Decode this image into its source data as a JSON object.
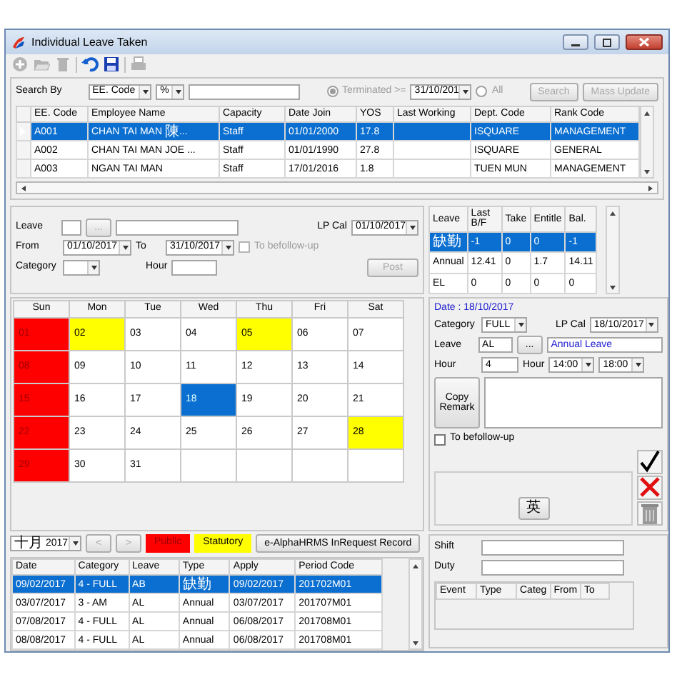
{
  "window": {
    "title": "Individual Leave Taken"
  },
  "toolbar": [
    {
      "kind": "add",
      "disabled": true
    },
    {
      "kind": "open",
      "disabled": true
    },
    {
      "kind": "delete",
      "disabled": true
    },
    {
      "kind": "undo",
      "disabled": false
    },
    {
      "kind": "save",
      "disabled": false
    },
    {
      "kind": "print",
      "disabled": true
    }
  ],
  "search": {
    "label": "Search By",
    "field": "EE. Code",
    "operator": "%",
    "terminated_option": {
      "label": "Terminated >=",
      "selected": true,
      "date": "31/10/201"
    },
    "all_option": {
      "label": "All",
      "selected": false
    },
    "buttons": [
      {
        "label": "Search",
        "disabled": true
      },
      {
        "label": "Mass Update",
        "disabled": true
      }
    ]
  },
  "employees": {
    "columns": [
      "EE. Code",
      "Employee Name",
      "Capacity",
      "Date Join",
      "YOS",
      "Last Working",
      "Dept. Code",
      "Rank Code"
    ],
    "rows": [
      {
        "cells": [
          "A001",
          "CHAN TAI MAN 陳...",
          "Staff",
          "01/01/2000",
          "17.8",
          "",
          "ISQUARE",
          "MANAGEMENT"
        ],
        "selected": true
      },
      {
        "cells": [
          "A002",
          "CHAN TAI MAN JOE ...",
          "Staff",
          "01/01/1990",
          "27.8",
          "",
          "ISQUARE",
          "GENERAL"
        ],
        "selected": false
      },
      {
        "cells": [
          "A003",
          "NGAN TAI MAN",
          "Staff",
          "17/01/2016",
          "1.8",
          "",
          "TUEN MUN",
          "MANAGEMENT"
        ],
        "selected": false
      }
    ]
  },
  "leave_form": {
    "leave_label": "Leave",
    "leave_picker": "...",
    "lp_cal_label": "LP Cal",
    "lp_cal": "01/10/2017",
    "from_label": "From",
    "from": "01/10/2017",
    "to_label": "To",
    "to": "31/10/2017",
    "follow_up": {
      "label": "To befollow-up",
      "checked": false,
      "disabled": true
    },
    "category_label": "Category",
    "hour_label": "Hour",
    "post_button": {
      "label": "Post",
      "disabled": true
    }
  },
  "balances": {
    "columns": [
      "Leave",
      "Last B/F",
      "Take",
      "Entitle",
      "Bal."
    ],
    "rows": [
      {
        "cells": [
          "缺勤",
          "-1",
          "0",
          "0",
          "-1"
        ],
        "selected": true
      },
      {
        "cells": [
          "Annual",
          "12.41",
          "0",
          "1.7",
          "14.11"
        ],
        "selected": false
      },
      {
        "cells": [
          "EL",
          "0",
          "0",
          "0",
          "0"
        ],
        "selected": false
      }
    ]
  },
  "calendar": {
    "weekdays": [
      "Sun",
      "Mon",
      "Tue",
      "Wed",
      "Thu",
      "Fri",
      "Sat"
    ],
    "days": [
      {
        "label": "01",
        "kind": "public",
        "selected": false
      },
      {
        "label": "02",
        "kind": "statutory",
        "selected": false
      },
      {
        "label": "03",
        "kind": "normal",
        "selected": false
      },
      {
        "label": "04",
        "kind": "normal",
        "selected": false
      },
      {
        "label": "05",
        "kind": "statutory",
        "selected": false
      },
      {
        "label": "06",
        "kind": "normal",
        "selected": false
      },
      {
        "label": "07",
        "kind": "normal",
        "selected": false
      },
      {
        "label": "08",
        "kind": "public",
        "selected": false
      },
      {
        "label": "09",
        "kind": "normal",
        "selected": false
      },
      {
        "label": "10",
        "kind": "normal",
        "selected": false
      },
      {
        "label": "11",
        "kind": "normal",
        "selected": false
      },
      {
        "label": "12",
        "kind": "normal",
        "selected": false
      },
      {
        "label": "13",
        "kind": "normal",
        "selected": false
      },
      {
        "label": "14",
        "kind": "normal",
        "selected": false
      },
      {
        "label": "15",
        "kind": "public",
        "selected": false
      },
      {
        "label": "16",
        "kind": "normal",
        "selected": false
      },
      {
        "label": "17",
        "kind": "normal",
        "selected": false
      },
      {
        "label": "18",
        "kind": "normal",
        "selected": true
      },
      {
        "label": "19",
        "kind": "normal",
        "selected": false
      },
      {
        "label": "20",
        "kind": "normal",
        "selected": false
      },
      {
        "label": "21",
        "kind": "normal",
        "selected": false
      },
      {
        "label": "22",
        "kind": "public",
        "selected": false
      },
      {
        "label": "23",
        "kind": "normal",
        "selected": false
      },
      {
        "label": "24",
        "kind": "normal",
        "selected": false
      },
      {
        "label": "25",
        "kind": "normal",
        "selected": false
      },
      {
        "label": "26",
        "kind": "normal",
        "selected": false
      },
      {
        "label": "27",
        "kind": "normal",
        "selected": false
      },
      {
        "label": "28",
        "kind": "statutory",
        "selected": false
      },
      {
        "label": "29",
        "kind": "public",
        "selected": false
      },
      {
        "label": "30",
        "kind": "normal",
        "selected": false
      },
      {
        "label": "31",
        "kind": "normal",
        "selected": false
      }
    ]
  },
  "detail": {
    "date_label": "Date : 18/10/2017",
    "category_label": "Category",
    "category": "FULL",
    "lp_cal_label": "LP Cal",
    "lp_cal": "18/10/2017",
    "leave_label": "Leave",
    "leave": "AL",
    "leave_picker": "...",
    "leave_name": "Annual Leave",
    "hour_label": "Hour",
    "hour": "4",
    "time_label": "Hour",
    "from_time": "14:00",
    "to_time": "18:00",
    "copy_button": "Copy Remark",
    "follow_up": {
      "label": "To befollow-up",
      "checked": false,
      "disabled": false
    },
    "ime_button": "英"
  },
  "month_bar": {
    "month": "十月 2017",
    "prev": {
      "label": "<",
      "disabled": true
    },
    "next": {
      "label": ">",
      "disabled": true
    },
    "legend": [
      {
        "label": "Public",
        "color": "#ff0000"
      },
      {
        "label": "Statutory",
        "color": "#ffff00"
      }
    ],
    "request_button": "e-AlphaHRMS InRequest Record"
  },
  "history": {
    "columns": [
      "Date",
      "Category",
      "Leave",
      "Type",
      "Apply",
      "Period Code"
    ],
    "rows": [
      {
        "cells": [
          "09/02/2017",
          "4 - FULL",
          "AB",
          "缺勤",
          "09/02/2017",
          "201702M01"
        ],
        "selected": true
      },
      {
        "cells": [
          "03/07/2017",
          "3 - AM",
          "AL",
          "Annual",
          "03/07/2017",
          "201707M01"
        ],
        "selected": false
      },
      {
        "cells": [
          "07/08/2017",
          "4 - FULL",
          "AL",
          "Annual",
          "06/08/2017",
          "201708M01"
        ],
        "selected": false
      },
      {
        "cells": [
          "08/08/2017",
          "4 - FULL",
          "AL",
          "Annual",
          "06/08/2017",
          "201708M01"
        ],
        "selected": false
      }
    ]
  },
  "shift_panel": {
    "shift_label": "Shift",
    "duty_label": "Duty",
    "event_columns": [
      "Event",
      "Type",
      "Categ",
      "From",
      "To"
    ]
  }
}
